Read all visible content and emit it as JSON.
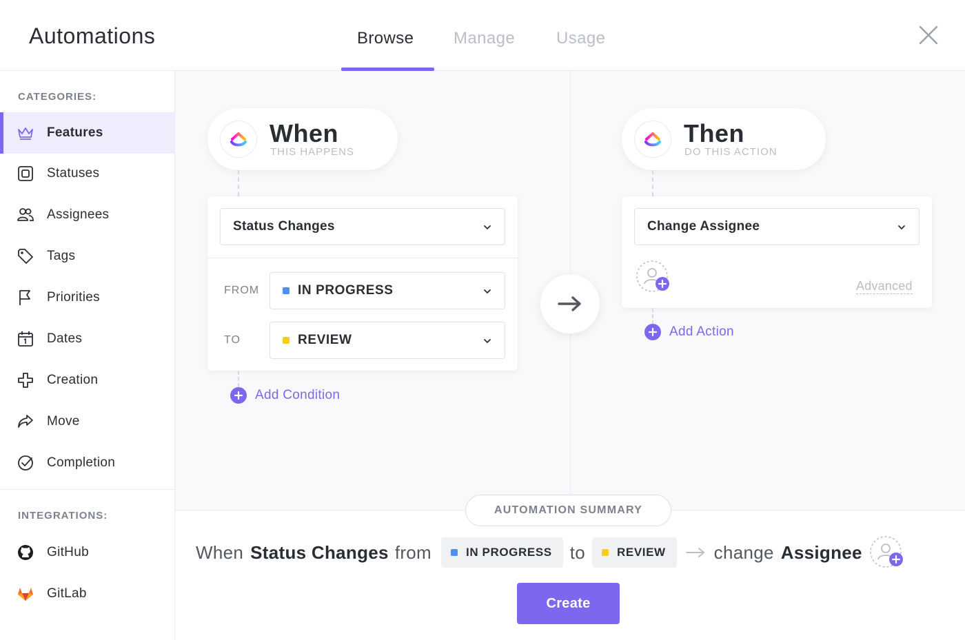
{
  "app": {
    "title": "Automations"
  },
  "tabs": [
    {
      "label": "Browse",
      "active": true
    },
    {
      "label": "Manage",
      "active": false
    },
    {
      "label": "Usage",
      "active": false
    }
  ],
  "sidebar": {
    "categories_label": "CATEGORIES:",
    "items": [
      {
        "label": "Features",
        "icon": "crown-icon",
        "active": true
      },
      {
        "label": "Statuses",
        "icon": "status-square-icon"
      },
      {
        "label": "Assignees",
        "icon": "people-icon"
      },
      {
        "label": "Tags",
        "icon": "tag-icon"
      },
      {
        "label": "Priorities",
        "icon": "flag-icon"
      },
      {
        "label": "Dates",
        "icon": "calendar-icon"
      },
      {
        "label": "Creation",
        "icon": "plus-outline-icon"
      },
      {
        "label": "Move",
        "icon": "share-arrow-icon"
      },
      {
        "label": "Completion",
        "icon": "check-circle-icon"
      }
    ],
    "integrations_label": "INTEGRATIONS:",
    "integrations": [
      {
        "label": "GitHub",
        "icon": "github-icon"
      },
      {
        "label": "GitLab",
        "icon": "gitlab-icon"
      }
    ]
  },
  "when": {
    "title": "When",
    "subtitle": "THIS HAPPENS",
    "trigger": "Status Changes",
    "from_label": "FROM",
    "from_value": "IN PROGRESS",
    "from_color": "#4a90f5",
    "to_label": "TO",
    "to_value": "REVIEW",
    "to_color": "#fccb1e",
    "add_condition": "Add Condition"
  },
  "then": {
    "title": "Then",
    "subtitle": "DO THIS ACTION",
    "action": "Change Assignee",
    "advanced": "Advanced",
    "add_action": "Add Action"
  },
  "summary": {
    "badge": "AUTOMATION SUMMARY",
    "when_word": "When",
    "trigger": "Status Changes",
    "from_word": "from",
    "from_value": "IN PROGRESS",
    "to_word": "to",
    "to_value": "REVIEW",
    "change_word": "change",
    "target": "Assignee",
    "create_label": "Create"
  },
  "colors": {
    "accent": "#7b68ee",
    "blue_status": "#4a90f5",
    "yellow_status": "#fccb1e"
  }
}
